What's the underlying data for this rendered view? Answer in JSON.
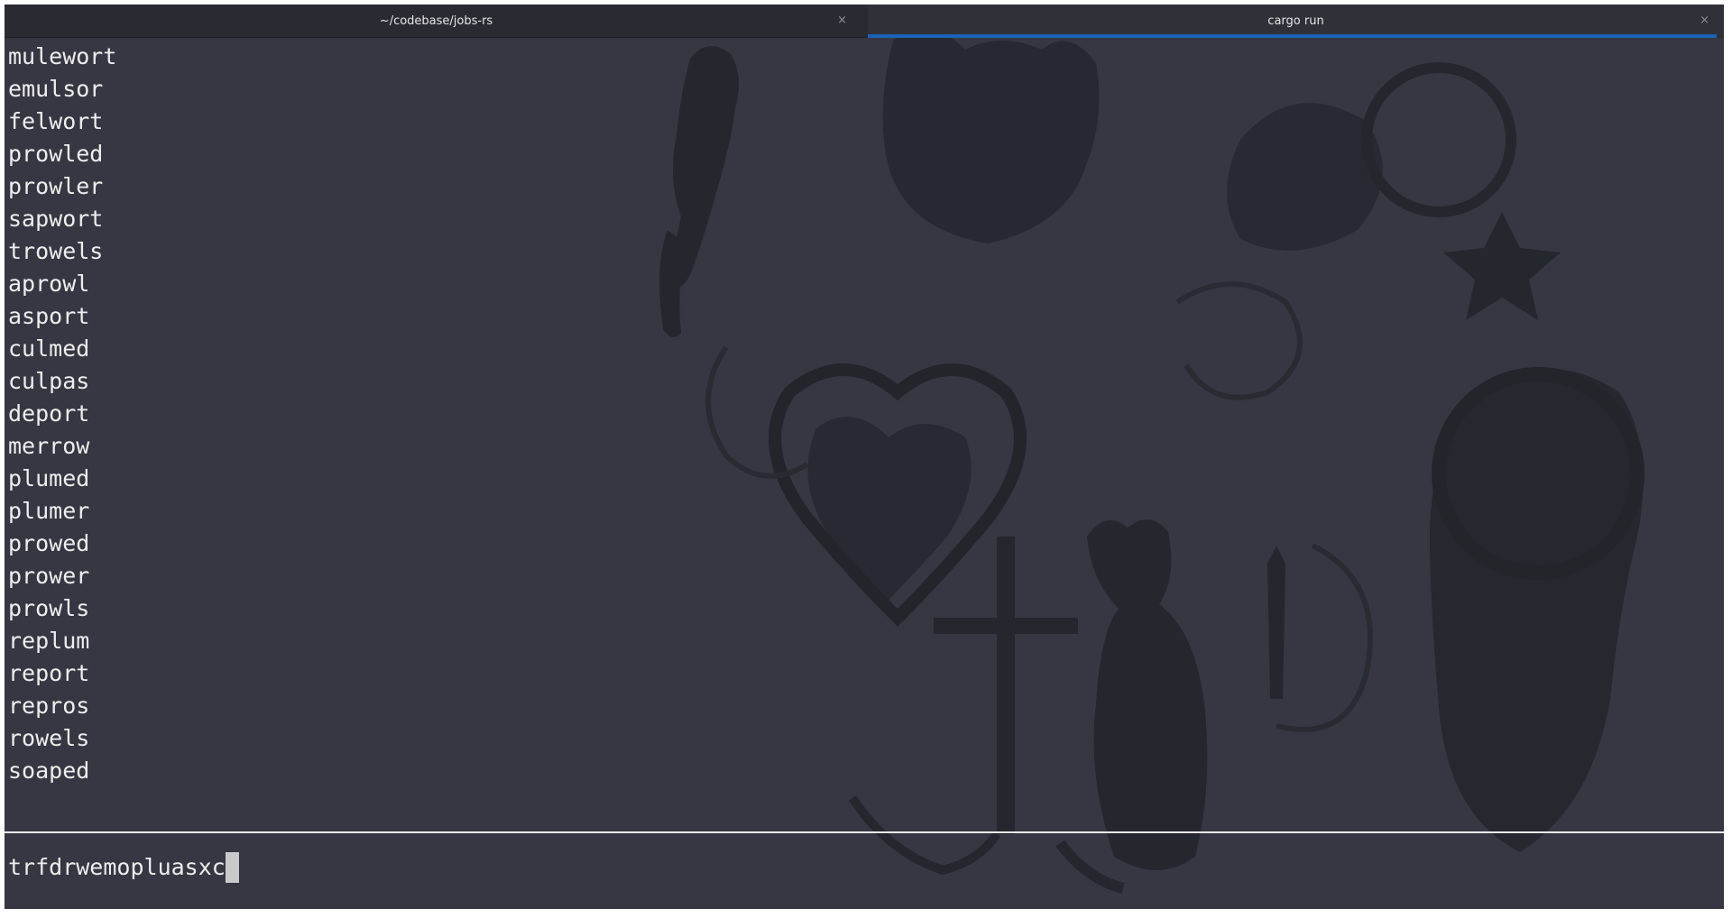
{
  "tabs": [
    {
      "title": "~/codebase/jobs-rs",
      "active": false
    },
    {
      "title": "cargo run",
      "active": true
    }
  ],
  "tab_close_glyph": "×",
  "output_lines": [
    "mulewort",
    "emulsor",
    "felwort",
    "prowled",
    "prowler",
    "sapwort",
    "trowels",
    "aprowl",
    "asport",
    "culmed",
    "culpas",
    "deport",
    "merrow",
    "plumed",
    "plumer",
    "prowed",
    "prower",
    "prowls",
    "replum",
    "report",
    "repros",
    "rowels",
    "soaped"
  ],
  "input": {
    "value": "trfdrwemopluasxc"
  },
  "colors": {
    "background": "#363742",
    "text": "#eeeeee",
    "active_tab_indicator": "#1a63b8",
    "divider": "#e8e8e8"
  },
  "background_art": "dark gothic cat illustrations wallpaper"
}
